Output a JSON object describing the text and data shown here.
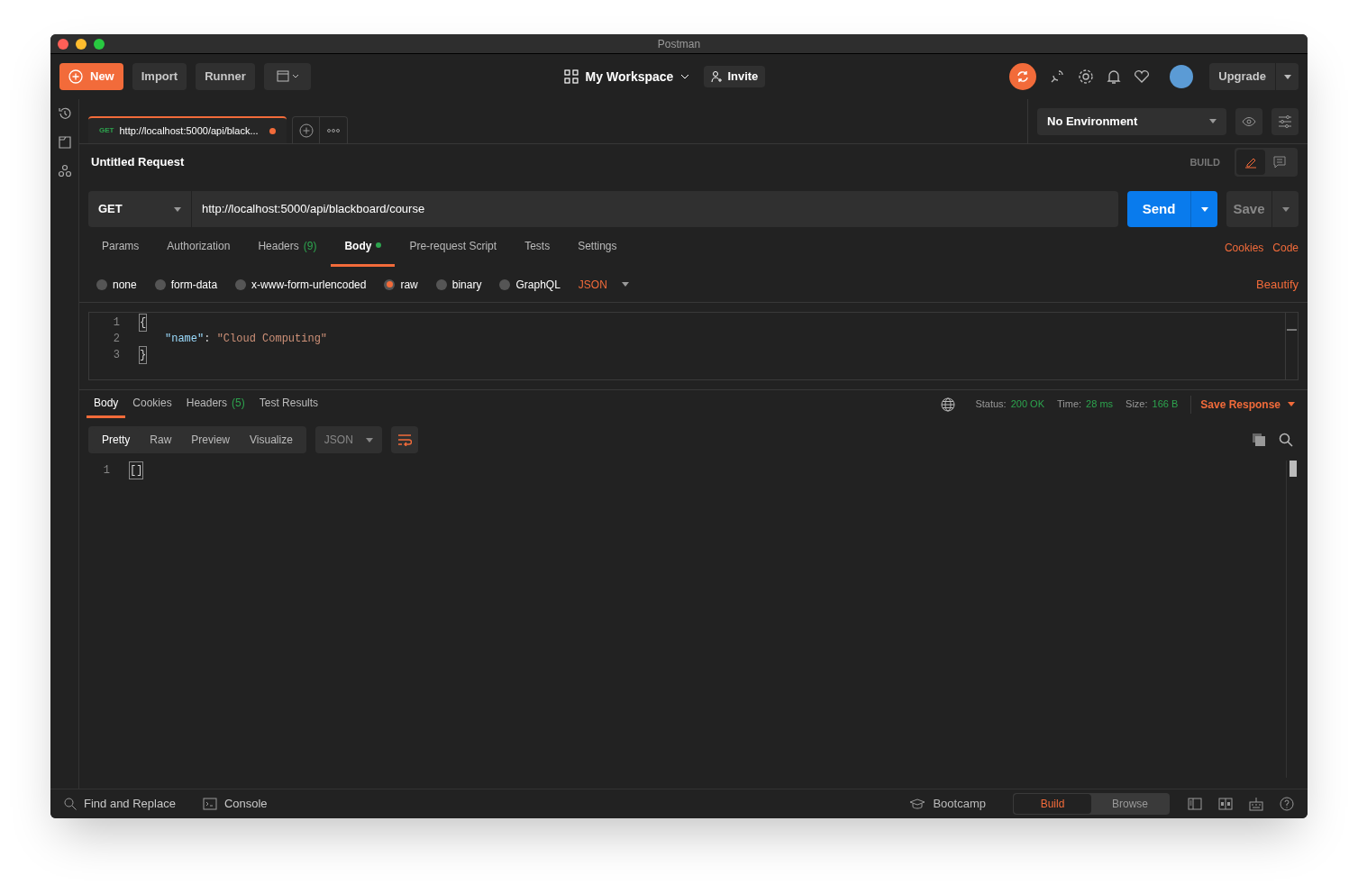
{
  "window": {
    "title": "Postman"
  },
  "toolbar": {
    "new": "New",
    "import": "Import",
    "runner": "Runner",
    "workspace": "My Workspace",
    "invite": "Invite",
    "upgrade": "Upgrade"
  },
  "request_tabs": [
    {
      "method": "GET",
      "url": "http://localhost:5000/api/black...",
      "unsaved": true,
      "selected": true
    }
  ],
  "environment": {
    "value": "No Environment"
  },
  "request": {
    "title": "Untitled Request",
    "mode_label": "BUILD",
    "method": "GET",
    "url": "http://localhost:5000/api/blackboard/course",
    "send": "Send",
    "save": "Save"
  },
  "mode_views": [
    {
      "kind": "edit",
      "selected": true
    },
    {
      "kind": "comments",
      "selected": false
    }
  ],
  "request_sections": [
    {
      "label": "Params",
      "indicator": false,
      "selected": false
    },
    {
      "label": "Authorization",
      "indicator": false,
      "selected": false
    },
    {
      "label": "Headers",
      "count": "(9)",
      "indicator": false,
      "selected": false
    },
    {
      "label": "Body",
      "indicator": true,
      "selected": true
    },
    {
      "label": "Pre-request Script",
      "indicator": false,
      "selected": false
    },
    {
      "label": "Tests",
      "indicator": false,
      "selected": false
    },
    {
      "label": "Settings",
      "indicator": false,
      "selected": false
    }
  ],
  "request_links": [
    "Cookies",
    "Code"
  ],
  "body_types": [
    {
      "label": "none",
      "selected": false
    },
    {
      "label": "form-data",
      "selected": false
    },
    {
      "label": "x-www-form-urlencoded",
      "selected": false
    },
    {
      "label": "raw",
      "selected": true
    },
    {
      "label": "binary",
      "selected": false
    },
    {
      "label": "GraphQL",
      "selected": false
    }
  ],
  "body_format": "JSON",
  "beautify": "Beautify",
  "request_body": [
    {
      "number": "1",
      "parts": [
        {
          "kind": "bracket",
          "text": "{"
        }
      ]
    },
    {
      "number": "2",
      "parts": [
        {
          "kind": "key",
          "text": "\"name\""
        },
        {
          "kind": "punct",
          "text": ": "
        },
        {
          "kind": "string",
          "text": "\"Cloud Computing\""
        }
      ]
    },
    {
      "number": "3",
      "parts": [
        {
          "kind": "bracket",
          "text": "}"
        }
      ]
    }
  ],
  "response_tabs": [
    {
      "label": "Body",
      "selected": true
    },
    {
      "label": "Cookies",
      "selected": false
    },
    {
      "label": "Headers",
      "count": "(5)",
      "selected": false
    },
    {
      "label": "Test Results",
      "selected": false
    }
  ],
  "response_meta": [
    {
      "label": "Status:",
      "value": "200 OK"
    },
    {
      "label": "Time:",
      "value": "28 ms"
    },
    {
      "label": "Size:",
      "value": "166 B"
    }
  ],
  "save_response": "Save Response",
  "view_modes": [
    {
      "label": "Pretty",
      "selected": true
    },
    {
      "label": "Raw",
      "selected": false
    },
    {
      "label": "Preview",
      "selected": false
    },
    {
      "label": "Visualize",
      "selected": false
    }
  ],
  "response_format": "JSON",
  "response_body": [
    {
      "number": "1",
      "parts": [
        {
          "kind": "bracket",
          "text": "[]"
        }
      ]
    }
  ],
  "footer": {
    "find": "Find and Replace",
    "console": "Console",
    "bootcamp": "Bootcamp",
    "modes": [
      {
        "label": "Build",
        "selected": true
      },
      {
        "label": "Browse",
        "selected": false
      }
    ]
  }
}
